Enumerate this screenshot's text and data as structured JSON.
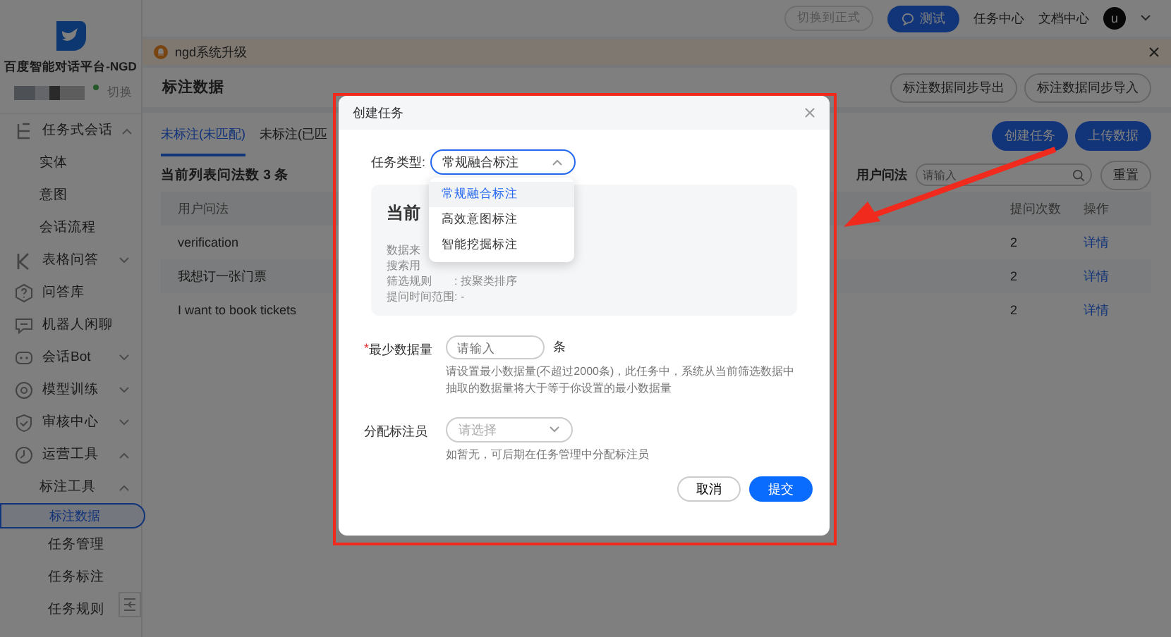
{
  "sidebar": {
    "title": "百度智能对话平台-NGD",
    "switch_label": "切换",
    "menu": [
      {
        "label": "任务式会话",
        "kind": "group",
        "expanded": true,
        "selected": false,
        "children": [
          {
            "label": "实体",
            "selected": false
          },
          {
            "label": "意图",
            "selected": false
          },
          {
            "label": "会话流程",
            "selected": false
          }
        ]
      },
      {
        "label": "表格问答",
        "kind": "group",
        "expanded": false,
        "selected": false
      },
      {
        "label": "问答库",
        "kind": "link",
        "selected": false
      },
      {
        "label": "机器人闲聊",
        "kind": "link",
        "selected": false
      },
      {
        "label": "会话Bot",
        "kind": "group",
        "expanded": false,
        "selected": false
      },
      {
        "label": "模型训练",
        "kind": "group",
        "expanded": false,
        "selected": false
      },
      {
        "label": "审核中心",
        "kind": "group",
        "expanded": false,
        "selected": false
      },
      {
        "label": "运营工具",
        "kind": "group",
        "expanded": true,
        "selected": false,
        "children": [
          {
            "label": "标注工具",
            "kind": "group",
            "expanded": true,
            "selected": false,
            "children": [
              {
                "label": "标注数据",
                "selected": true
              },
              {
                "label": "任务管理",
                "selected": false
              },
              {
                "label": "任务标注",
                "selected": false
              },
              {
                "label": "任务规则",
                "selected": false
              }
            ]
          }
        ]
      }
    ]
  },
  "topbar": {
    "env_button": "切换到正式",
    "test_button": "测试",
    "links": [
      "任务中心",
      "文档中心"
    ],
    "avatar": "u"
  },
  "banner": {
    "text": "ngd系统升级"
  },
  "page": {
    "title": "标注数据",
    "actions": [
      "标注数据同步导出",
      "标注数据同步导入"
    ]
  },
  "tabs": [
    {
      "label": "未标注(未匹配)",
      "selected": true
    },
    {
      "label": "未标注(已匹",
      "selected": false
    }
  ],
  "toolbar_buttons": [
    "创建任务",
    "上传数据"
  ],
  "count_text": "当前列表问法数 **3** 条",
  "filter": {
    "label": "用户问法",
    "placeholder": "请输入",
    "reset": "重置"
  },
  "table": {
    "columns": [
      "用户问法",
      "提问次数",
      "操作"
    ],
    "rows": [
      {
        "query": "verification",
        "count": "2",
        "action": "详情"
      },
      {
        "query": "我想订一张门票",
        "count": "2",
        "action": "详情"
      },
      {
        "query": "I want to book tickets",
        "count": "2",
        "action": "详情"
      }
    ]
  },
  "modal": {
    "title": "创建任务",
    "type_label": "任务类型:",
    "type_value": "常规融合标注",
    "dropdown_open": true,
    "options": [
      {
        "label": "常规融合标注",
        "selected": true
      },
      {
        "label": "高效意图标注",
        "selected": false
      },
      {
        "label": "智能挖掘标注",
        "selected": false
      }
    ],
    "info": {
      "title": "当前",
      "lines": [
        {
          "label": "数据来"
        },
        {
          "label": "搜索用"
        },
        {
          "label": "筛选规则",
          "value": ":  按聚类排序"
        },
        {
          "label": "提问时间范围",
          "value": ":  -"
        }
      ]
    },
    "min_label": "最少数据量",
    "required_mark": "*",
    "min_placeholder": "请输入",
    "min_unit": "条",
    "min_help": "请设置最小数据量(不超过2000条)，此任务中，系统从当前筛选数据中抽取的数据量将大于等于你设置的最小数据量",
    "assign_label": "分配标注员",
    "assign_placeholder": "请选择",
    "assign_help": "如暂无，可后期在任务管理中分配标注员",
    "cancel": "取消",
    "submit": "提交"
  }
}
